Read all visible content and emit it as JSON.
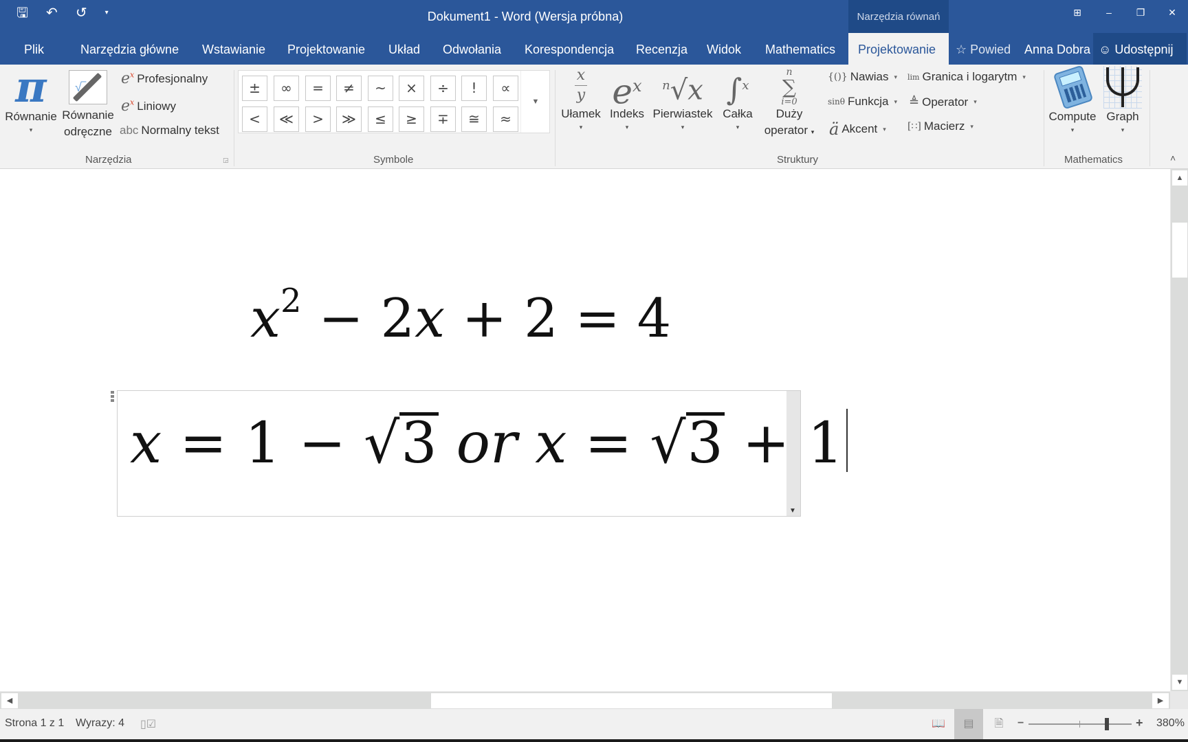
{
  "titlebar": {
    "title": "Dokument1 - Word (Wersja próbna)",
    "context_tab_title": "Narzędzia równań",
    "qat": {
      "save_icon": "🖫",
      "undo_icon": "↶",
      "redo_icon": "↺",
      "customize_icon": "▾"
    },
    "window_controls": {
      "ribbon_display": "⊞",
      "minimize": "–",
      "restore": "❐",
      "close": "✕"
    }
  },
  "tabs": [
    {
      "label": "Plik"
    },
    {
      "label": "Narzędzia główne"
    },
    {
      "label": "Wstawianie"
    },
    {
      "label": "Projektowanie"
    },
    {
      "label": "Układ"
    },
    {
      "label": "Odwołania"
    },
    {
      "label": "Korespondencja"
    },
    {
      "label": "Recenzja"
    },
    {
      "label": "Widok"
    },
    {
      "label": "Mathematics"
    },
    {
      "label": "Projektowanie",
      "active": true
    }
  ],
  "tell_me": {
    "icon": "☆",
    "label": "Powied",
    "user": "Anna Dobra"
  },
  "share": {
    "icon": "☺",
    "label": "Udostępnij"
  },
  "ribbon": {
    "groups": {
      "narzedzia": {
        "label": "Narzędzia",
        "equation": {
          "label": "Równanie",
          "icon": "π"
        },
        "ink_equation": {
          "label_line1": "Równanie",
          "label_line2": "odręczne"
        },
        "professional": {
          "label": "Profesjonalny"
        },
        "linear": {
          "label": "Liniowy"
        },
        "normal_text": {
          "icon": "abc",
          "label": "Normalny tekst"
        }
      },
      "symbole": {
        "label": "Symbole",
        "symbols_row1": [
          "±",
          "∞",
          "=",
          "≠",
          "~",
          "×",
          "÷",
          "!",
          "∝"
        ],
        "symbols_row2": [
          "<",
          "≪",
          ">",
          "≫",
          "≤",
          "≥",
          "∓",
          "≅",
          "≈"
        ],
        "more_icon": "▼"
      },
      "struktury": {
        "label": "Struktury",
        "fraction": {
          "label": "Ułamek"
        },
        "script": {
          "label": "Indeks"
        },
        "radical": {
          "label": "Pierwiastek"
        },
        "integral": {
          "label": "Całka"
        },
        "large_operator": {
          "label_line1": "Duży",
          "label_line2": "operator"
        },
        "bracket": {
          "icon": "{()}",
          "label": "Nawias"
        },
        "function": {
          "icon": "sinθ",
          "label": "Funkcja"
        },
        "accent": {
          "icon": "ä",
          "label": "Akcent"
        },
        "limit_log": {
          "icon": "lim",
          "label": "Granica i logarytm"
        },
        "operator": {
          "icon": "≜",
          "label": "Operator"
        },
        "matrix": {
          "icon": "[∷]",
          "label": "Macierz"
        }
      },
      "mathematics": {
        "label": "Mathematics",
        "compute": {
          "label": "Compute"
        },
        "graph": {
          "label": "Graph"
        }
      }
    },
    "collapse_icon": "˄"
  },
  "document": {
    "equation1": {
      "x": "x",
      "exp": "2",
      "rest": " − 2",
      "x2": "x",
      "tail": " + 2 = 4"
    },
    "equation2": {
      "x1": "x",
      "part1": " = 1 − ",
      "sqrt1": "3",
      "or": "or",
      "x2": "x",
      "part2": " = ",
      "sqrt2": "3",
      "tail": " + 1"
    }
  },
  "statusbar": {
    "page": "Strona 1 z 1",
    "words": "Wyrazy: 4",
    "zoom_percent": "380%",
    "zoom_level_fraction": 0.76
  }
}
